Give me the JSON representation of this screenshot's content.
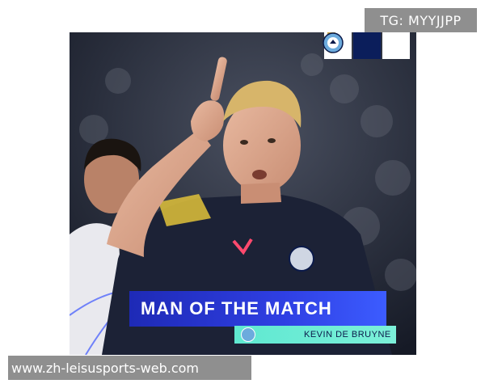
{
  "watermark_top": "TG: MYYJJPP",
  "watermark_bottom": "www.zh-leisusports-web.com",
  "card": {
    "motm_label": "MAN OF THE MATCH",
    "player_name": "KEVIN DE BRUYNE",
    "crests": [
      "real-madrid-crest-icon",
      "champions-league-starball-icon",
      "manchester-city-crest-icon"
    ]
  },
  "colors": {
    "motm_blue": "#2f3fe3",
    "player_bar_teal": "#6ef0d6",
    "jersey_navy": "#1c2236",
    "watermark_gray": "#8f8f8f"
  }
}
